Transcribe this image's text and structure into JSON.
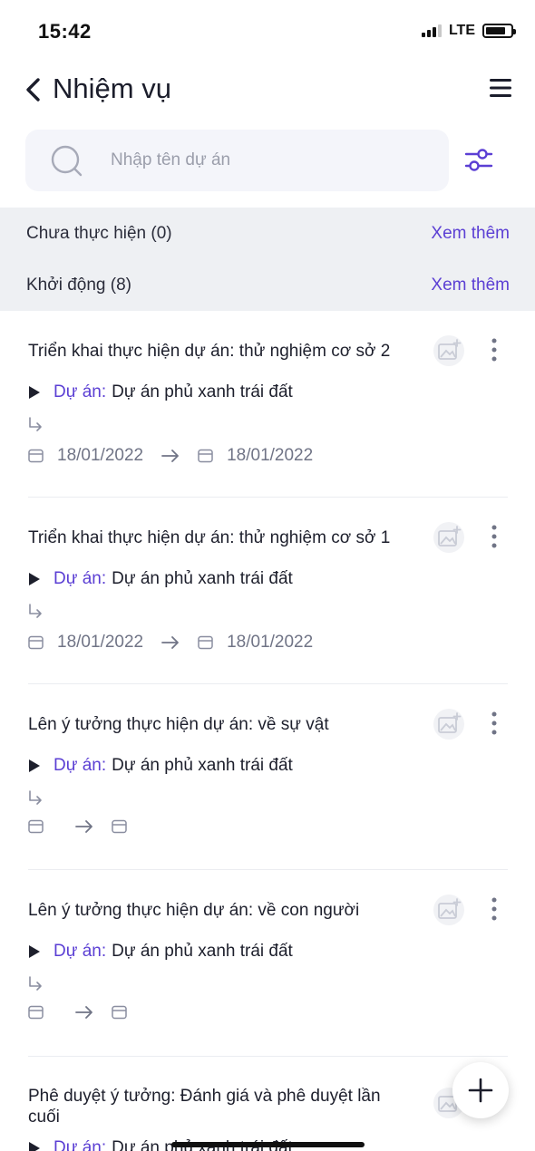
{
  "status_bar": {
    "time": "15:42",
    "network": "LTE"
  },
  "nav": {
    "title": "Nhiệm vụ"
  },
  "search": {
    "placeholder": "Nhập tên dự án",
    "value": ""
  },
  "groups": [
    {
      "label": "Chưa thực hiện (0)",
      "more": "Xem thêm"
    },
    {
      "label": "Khởi động (8)",
      "more": "Xem thêm"
    }
  ],
  "tasks": [
    {
      "title": "Triển khai thực hiện dự án: thử nghiệm cơ sở 2",
      "project_key": "Dự án:",
      "project_name": "Dự án phủ xanh trái đất",
      "start": "18/01/2022",
      "end": "18/01/2022"
    },
    {
      "title": "Triển khai thực hiện dự án: thử nghiệm cơ sở 1",
      "project_key": "Dự án:",
      "project_name": "Dự án phủ xanh trái đất",
      "start": "18/01/2022",
      "end": "18/01/2022"
    },
    {
      "title": "Lên ý tưởng thực hiện dự án: về sự vật",
      "project_key": "Dự án:",
      "project_name": "Dự án phủ xanh trái đất",
      "start": "",
      "end": ""
    },
    {
      "title": "Lên ý tưởng thực hiện dự án: về con người",
      "project_key": "Dự án:",
      "project_name": "Dự án phủ xanh trái đất",
      "start": "",
      "end": ""
    },
    {
      "title": "Phê duyệt ý tưởng: Đánh giá và phê duyệt lần cuối",
      "project_key": "Dự án:",
      "project_name": "Dự án phủ xanh trái đất"
    }
  ],
  "colors": {
    "accent": "#5b3fd4",
    "group_bg": "#eef0f3",
    "search_bg": "#f4f5fa",
    "meta_text": "#707486"
  },
  "icons": [
    "back-icon",
    "menu-icon",
    "search-icon",
    "filter-icon",
    "add-image-icon",
    "more-vertical-icon",
    "play-icon",
    "subtask-icon",
    "calendar-icon",
    "arrow-right-icon",
    "plus-icon"
  ]
}
